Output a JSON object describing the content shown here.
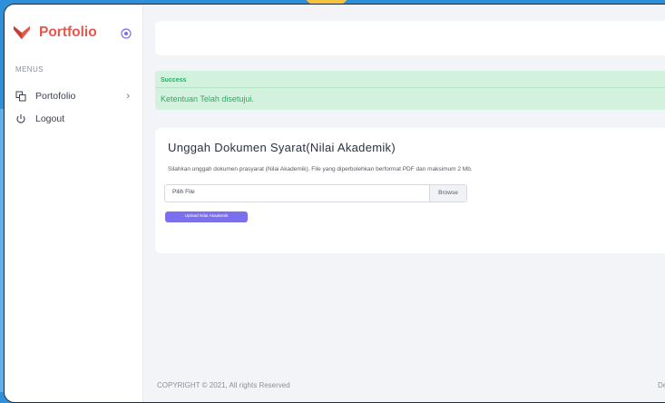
{
  "brand": {
    "name": "Portfolio",
    "logo_icon": "heart-logo-icon",
    "collapse_icon": "target-circle-icon"
  },
  "sidebar": {
    "section_label": "MENUS",
    "items": [
      {
        "label": "Portofolio",
        "icon": "copy-icon",
        "chevron": "›"
      },
      {
        "label": "Logout",
        "icon": "power-icon"
      }
    ]
  },
  "alert": {
    "title": "Success",
    "message": "Ketentuan Telah disetujui."
  },
  "card": {
    "title": "Unggah Dokumen Syarat(Nilai Akademik)",
    "description": "Silahkan unggah dokumen prasyarat (Nilai Akademik). File yang diperbolehkan berformat PDF dan maksimum 2 Mb.",
    "file_placeholder": "Pilih File",
    "browse_label": "Browse",
    "upload_button": "Upload Nilai Akademik"
  },
  "footer": {
    "copyright": "COPYRIGHT © 2021, All rights Reserved",
    "right_text": "De"
  },
  "colors": {
    "brand": "#e5574d",
    "success_bg": "#d3f2de",
    "success_text": "#27ae60",
    "primary": "#7b6ff0"
  }
}
